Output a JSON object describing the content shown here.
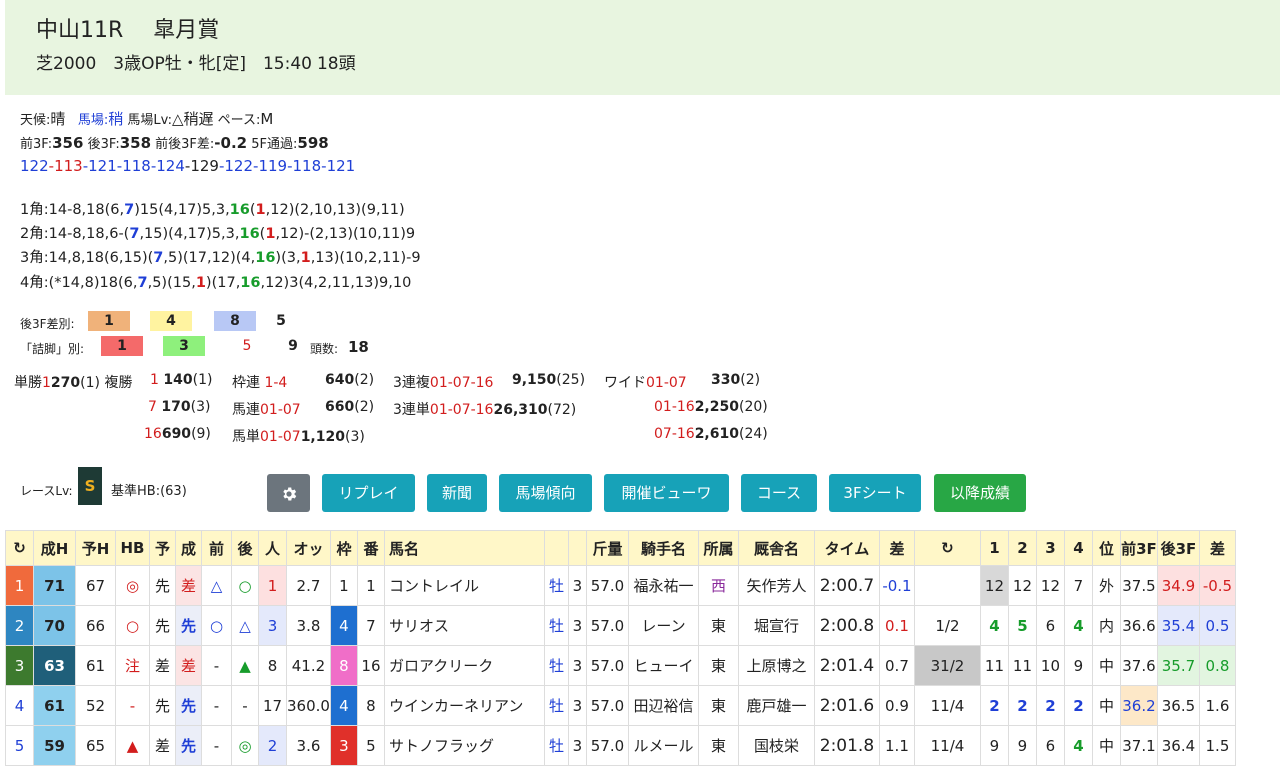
{
  "header": {
    "race": "中山11R",
    "name": "皐月賞",
    "course": "芝2000",
    "class": "3歳OP牡・牝[定]",
    "time": "15:40",
    "heads": "18頭"
  },
  "conditions": {
    "weather_label": "天候:",
    "weather": "晴",
    "track_label": "馬場:",
    "track": "稍",
    "tracklv_label": "馬場Lv:",
    "tracklv": "△稍遅",
    "pace_label": "ペース:",
    "pace": "M",
    "f3_label": "前3F:",
    "f3": "356",
    "l3_label": "後3F:",
    "l3": "358",
    "diff_label": "前後3F差:",
    "diff": "-0.2",
    "f5_label": "5F通過:",
    "f5": "598",
    "laps": [
      "122",
      "113",
      "121",
      "118",
      "124",
      "129",
      "122",
      "119",
      "118",
      "121"
    ]
  },
  "corners": [
    "1角:14-8,18(6,7)15(4,17)5,3,16(1,12)(2,10,13)(9,11)",
    "2角:14-8,18,6-(7,15)(4,17)5,3,16(1,12)-(2,13)(10,11)9",
    "3角:14,8,18(6,15)(7,5)(17,12)(4,16)(3,1,13)(10,2,11)-9",
    "4角:(*14,8)18(6,7,5)(15,1)(17,16,12)3(4,2,11,13)9,10"
  ],
  "after3f": {
    "label": "後3F差別:",
    "values": [
      "1",
      "4",
      "8",
      "5"
    ],
    "colors": [
      "#f0b27a",
      "#fff3a0",
      "#b8c8f5",
      "#ffffff"
    ]
  },
  "tsumeashi": {
    "label": "「詰脚」別:",
    "values": [
      "1",
      "3",
      "5",
      "9"
    ],
    "colors": [
      "#f46a6a",
      "#8ef07c",
      "#ffffff",
      "#ffffff"
    ],
    "count_label": "頭数:",
    "count": "18"
  },
  "payouts": {
    "tansho_label": "単勝",
    "tansho": {
      "num": "1",
      "amt": "270",
      "pop": "(1)"
    },
    "fukusho_label": "複勝",
    "fukusho": [
      {
        "num": "1",
        "amt": "140",
        "pop": "(1)"
      },
      {
        "num": "7",
        "amt": "170",
        "pop": "(3)"
      },
      {
        "num": "16",
        "amt": "690",
        "pop": "(9)"
      }
    ],
    "wakuren_label": "枠連",
    "wakuren": {
      "num": "1-4",
      "amt": "640",
      "pop": "(2)"
    },
    "umaren_label": "馬連",
    "umaren": {
      "num": "01-07",
      "amt": "660",
      "pop": "(2)"
    },
    "umatan_label": "馬単",
    "umatan": {
      "num": "01-07",
      "amt": "1,120",
      "pop": "(3)"
    },
    "sanrenpuku_label": "3連複",
    "sanrenpuku": {
      "num": "01-07-16",
      "amt": "9,150",
      "pop": "(25)"
    },
    "sanrentan_label": "3連単",
    "sanrentan": {
      "num": "01-07-16",
      "amt": "26,310",
      "pop": "(72)"
    },
    "wide_label": "ワイド",
    "wide": [
      {
        "num": "01-07",
        "amt": "330",
        "pop": "(2)"
      },
      {
        "num": "01-16",
        "amt": "2,250",
        "pop": "(20)"
      },
      {
        "num": "07-16",
        "amt": "2,610",
        "pop": "(24)"
      }
    ]
  },
  "racelv": {
    "label": "レースLv:",
    "value": "S",
    "hb": "基準HB:(63)"
  },
  "buttons": [
    "リプレイ",
    "新聞",
    "馬場傾向",
    "開催ビューワ",
    "コース",
    "3Fシート",
    "以降成績"
  ],
  "table": {
    "headers": [
      "",
      "成H",
      "予H",
      "HB",
      "予",
      "成",
      "前",
      "後",
      "人",
      "オッ",
      "枠",
      "番",
      "馬名",
      "",
      "",
      "斤量",
      "騎手名",
      "所属",
      "厩舎名",
      "タイム",
      "差",
      "",
      "1",
      "2",
      "3",
      "4",
      "位",
      "前3F",
      "後3F",
      "差"
    ],
    "rows": [
      [
        "1",
        "71",
        "67",
        "◎",
        "先",
        "差",
        "△",
        "○",
        "1",
        "2.7",
        "1",
        "1",
        "コントレイル",
        "牡",
        "3",
        "57.0",
        "福永祐一",
        "西",
        "矢作芳人",
        "2:00.7",
        "-0.1",
        "",
        "12",
        "12",
        "12",
        "7",
        "外",
        "37.5",
        "34.9",
        "-0.5"
      ],
      [
        "2",
        "70",
        "66",
        "○",
        "先",
        "先",
        "○",
        "△",
        "3",
        "3.8",
        "4",
        "7",
        "サリオス",
        "牡",
        "3",
        "57.0",
        "レーン",
        "東",
        "堀宣行",
        "2:00.8",
        "0.1",
        "1/2",
        "4",
        "5",
        "6",
        "4",
        "内",
        "36.6",
        "35.4",
        "0.5"
      ],
      [
        "3",
        "63",
        "61",
        "注",
        "差",
        "差",
        "-",
        "▲",
        "8",
        "41.2",
        "8",
        "16",
        "ガロアクリーク",
        "牡",
        "3",
        "57.0",
        "ヒューイ",
        "東",
        "上原博之",
        "2:01.4",
        "0.7",
        "31/2",
        "11",
        "11",
        "10",
        "9",
        "中",
        "37.6",
        "35.7",
        "0.8"
      ],
      [
        "4",
        "61",
        "52",
        "-",
        "先",
        "先",
        "-",
        "-",
        "17",
        "360.0",
        "4",
        "8",
        "ウインカーネリアン",
        "牡",
        "3",
        "57.0",
        "田辺裕信",
        "東",
        "鹿戸雄一",
        "2:01.6",
        "0.9",
        "11/4",
        "2",
        "2",
        "2",
        "2",
        "中",
        "36.2",
        "36.5",
        "1.6"
      ],
      [
        "5",
        "59",
        "65",
        "▲",
        "差",
        "先",
        "-",
        "◎",
        "2",
        "3.6",
        "3",
        "5",
        "サトノフラッグ",
        "牡",
        "3",
        "57.0",
        "ルメール",
        "東",
        "国枝栄",
        "2:01.8",
        "1.1",
        "11/4",
        "9",
        "9",
        "6",
        "4",
        "中",
        "37.1",
        "36.4",
        "1.5"
      ]
    ]
  }
}
